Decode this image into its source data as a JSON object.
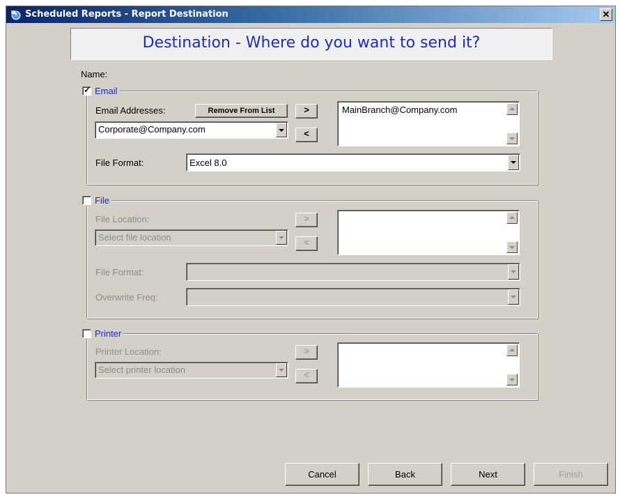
{
  "window": {
    "title": "Scheduled Reports - Report Destination",
    "close_glyph": "✕"
  },
  "header": {
    "text": "Destination - Where do you want to send it?"
  },
  "name_label": "Name:",
  "email": {
    "legend": "Email",
    "checked": true,
    "addresses_label": "Email Addresses:",
    "remove_button": "Remove From List",
    "address_value": "Corporate@Company.com",
    "add_arrow": ">",
    "remove_arrow": "<",
    "list_items": [
      "MainBranch@Company.com"
    ],
    "file_format_label": "File Format:",
    "file_format_value": "Excel 8.0"
  },
  "file": {
    "legend": "File",
    "checked": false,
    "location_label": "File Location:",
    "location_value": "Select file location",
    "add_arrow": ">",
    "remove_arrow": "<",
    "file_format_label": "File Format:",
    "overwrite_label": "Overwrite Freq:"
  },
  "printer": {
    "legend": "Printer",
    "checked": false,
    "location_label": "Printer Location:",
    "location_value": "Select printer location",
    "add_arrow": ">",
    "remove_arrow": "<"
  },
  "buttons": {
    "cancel": "Cancel",
    "back": "Back",
    "next": "Next",
    "finish": "Finish"
  },
  "colors": {
    "title_bar": "#0a246a",
    "header_text": "#1c2cc0",
    "dialog_bg": "#d4d0c8"
  },
  "icons": {
    "title": "scheduled-reports-icon",
    "close": "close-icon"
  }
}
